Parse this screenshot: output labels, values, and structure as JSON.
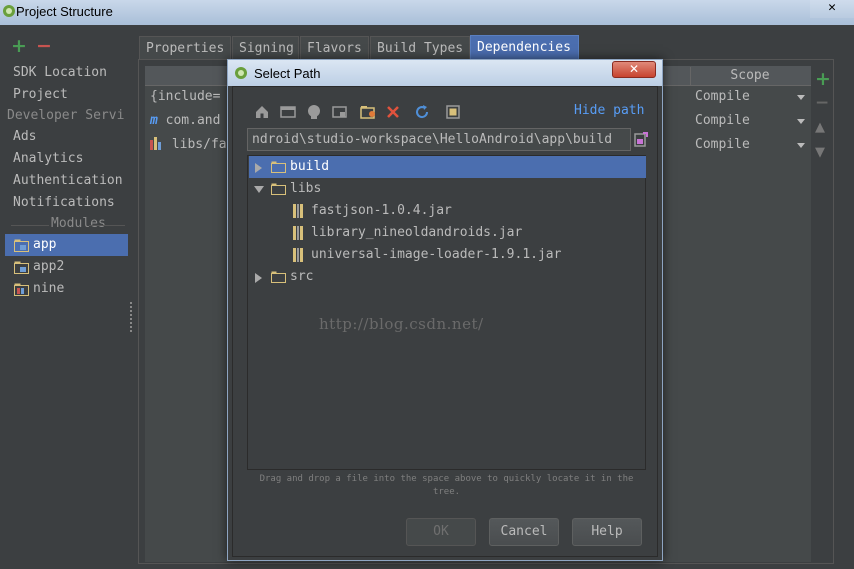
{
  "window": {
    "title": "Project Structure",
    "close_glyph": "✕"
  },
  "toolbar": {
    "add_glyph": "+",
    "remove_glyph": "−"
  },
  "sidebar": {
    "items": [
      "SDK Location",
      "Project",
      "Developer Servi",
      "Ads",
      "Analytics",
      "Authentication",
      "Notifications"
    ],
    "modules_label": "Modules",
    "modules": [
      "app",
      "app2",
      "nine"
    ]
  },
  "tabs": [
    "Properties",
    "Signing",
    "Flavors",
    "Build Types",
    "Dependencies"
  ],
  "dependencies": {
    "scope_header": "Scope",
    "rows": [
      {
        "name": "{include=",
        "scope": "Compile"
      },
      {
        "name": "com.and",
        "scope": "Compile"
      },
      {
        "name": "libs/fa",
        "scope": "Compile"
      }
    ],
    "row_icons": [
      "",
      "m",
      "chart-icon"
    ]
  },
  "dialog": {
    "title": "Select Path",
    "close_glyph": "✕",
    "hide_path_label": "Hide path",
    "path_value": "ndroid\\studio-workspace\\HelloAndroid\\app\\build",
    "tree": [
      {
        "label": "build",
        "type": "folder",
        "expanded": false,
        "selected": true,
        "level": 0
      },
      {
        "label": "libs",
        "type": "folder",
        "expanded": true,
        "selected": false,
        "level": 0
      },
      {
        "label": "fastjson-1.0.4.jar",
        "type": "jar",
        "level": 1
      },
      {
        "label": "library_nineoldandroids.jar",
        "type": "jar",
        "level": 1
      },
      {
        "label": "universal-image-loader-1.9.1.jar",
        "type": "jar",
        "level": 1
      },
      {
        "label": "src",
        "type": "folder",
        "expanded": false,
        "selected": false,
        "level": 0
      }
    ],
    "watermark": "http://blog.csdn.net/",
    "hint": "Drag and drop a file into the space above to quickly locate it in the tree.",
    "ok_label": "OK",
    "cancel_label": "Cancel",
    "help_label": "Help"
  },
  "colors": {
    "accent": "#4b6eaf",
    "link": "#589df6",
    "add": "#499c54",
    "remove": "#c75450"
  }
}
